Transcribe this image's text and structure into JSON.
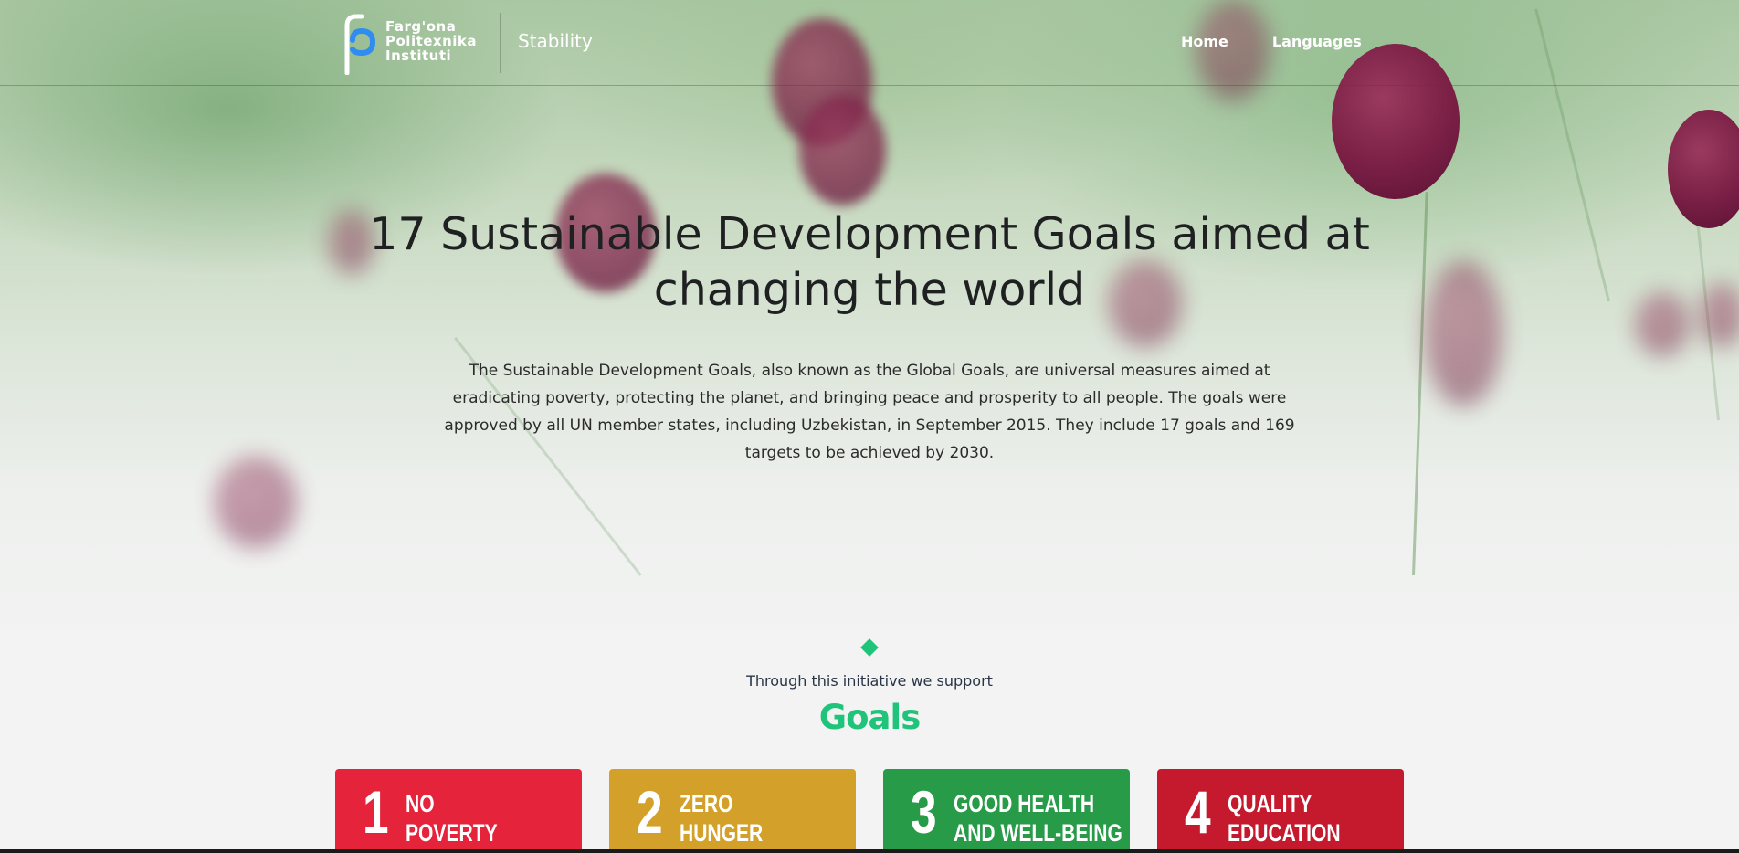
{
  "header": {
    "logo_lines": [
      "Farg'ona",
      "Politexnika",
      "Instituti"
    ],
    "site_title": "Stability",
    "nav": [
      {
        "label": "Home"
      },
      {
        "label": "Languages"
      }
    ]
  },
  "hero": {
    "title": "17 Sustainable Development Goals aimed at changing the world",
    "description": "The Sustainable Development Goals, also known as the Global Goals, are universal measures aimed at eradicating poverty, protecting the planet, and bringing peace and prosperity to all people. The goals were approved by all UN member states, including Uzbekistan, in September 2015. They include 17 goals and 169 targets to be achieved by 2030."
  },
  "goals_section": {
    "kicker": "Through this initiative we support",
    "title": "Goals",
    "accent_color": "#1fc47a",
    "cards": [
      {
        "number": "1",
        "line1": "NO",
        "line2": "POVERTY",
        "color": "#e5243b"
      },
      {
        "number": "2",
        "line1": "ZERO",
        "line2": "HUNGER",
        "color": "#d3a029"
      },
      {
        "number": "3",
        "line1": "GOOD HEALTH",
        "line2": "AND WELL-BEING",
        "color": "#279b48"
      },
      {
        "number": "4",
        "line1": "QUALITY",
        "line2": "EDUCATION",
        "color": "#c5192d"
      }
    ]
  }
}
